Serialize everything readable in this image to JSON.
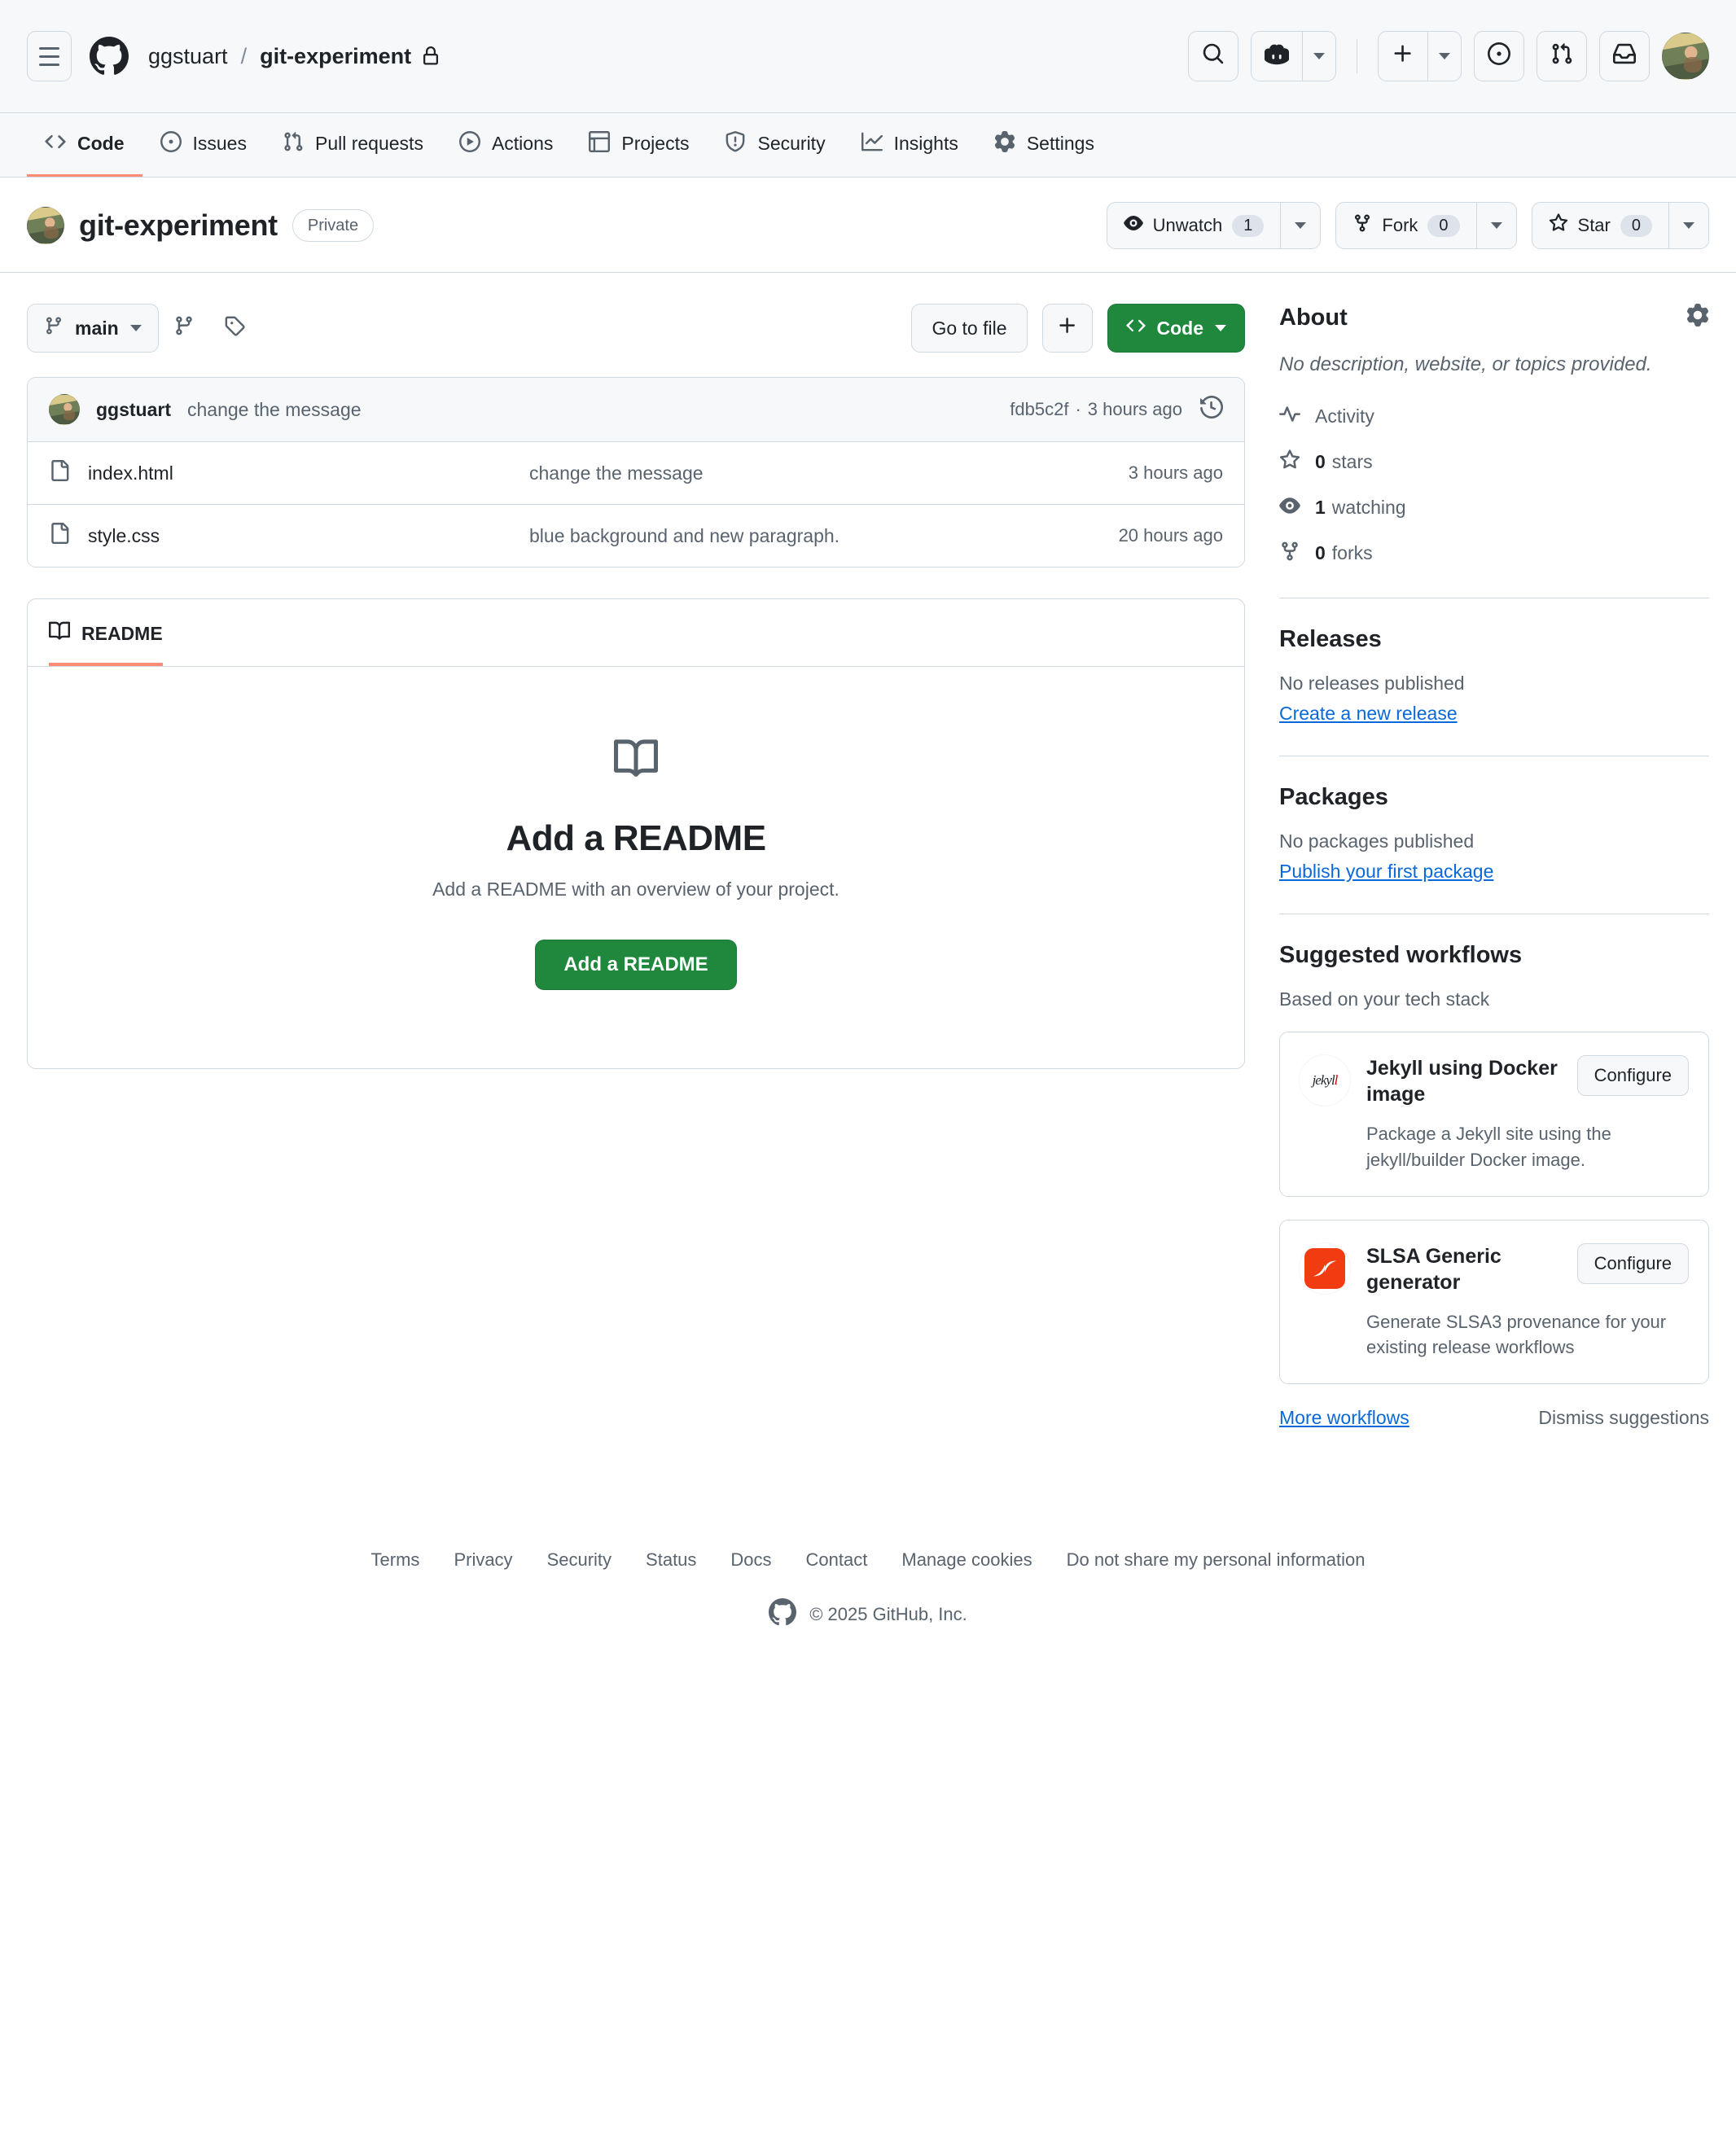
{
  "header": {
    "hamburger_label": "Open menu",
    "owner": "ggstuart",
    "separator": "/",
    "repo": "git-experiment",
    "icons": {
      "github_mark": "github-logo",
      "lock": "lock-icon",
      "search": "search-icon",
      "copilot": "copilot-icon",
      "plus": "plus-icon",
      "issues": "issue-opened-icon",
      "pull_requests": "git-pull-request-icon",
      "inbox": "inbox-icon"
    }
  },
  "repo_nav": {
    "tabs": [
      {
        "label": "Code",
        "icon": "code-icon",
        "active": true
      },
      {
        "label": "Issues",
        "icon": "issue-opened-icon",
        "active": false
      },
      {
        "label": "Pull requests",
        "icon": "git-pull-request-icon",
        "active": false
      },
      {
        "label": "Actions",
        "icon": "play-icon",
        "active": false
      },
      {
        "label": "Projects",
        "icon": "table-icon",
        "active": false
      },
      {
        "label": "Security",
        "icon": "shield-icon",
        "active": false
      },
      {
        "label": "Insights",
        "icon": "graph-icon",
        "active": false
      },
      {
        "label": "Settings",
        "icon": "gear-icon",
        "active": false
      }
    ]
  },
  "repo_title": {
    "name": "git-experiment",
    "visibility": "Private",
    "actions": {
      "watch_label": "Unwatch",
      "watch_count": "1",
      "fork_label": "Fork",
      "fork_count": "0",
      "star_label": "Star",
      "star_count": "0"
    }
  },
  "file_toolbar": {
    "branch": "main",
    "branches_icon": "git-branch-icon",
    "tags_icon": "tag-icon",
    "go_to_file": "Go to file",
    "add_file_icon": "plus-icon",
    "code_label": "Code"
  },
  "commit": {
    "author": "ggstuart",
    "message": "change the message",
    "sha": "fdb5c2f",
    "separator": "·",
    "relative_time": "3 hours ago",
    "history_icon": "history-icon"
  },
  "files": {
    "rows": [
      {
        "name": "index.html",
        "icon": "file-icon",
        "message": "change the message",
        "age": "3 hours ago"
      },
      {
        "name": "style.css",
        "icon": "file-icon",
        "message": "blue background and new paragraph.",
        "age": "20 hours ago"
      }
    ]
  },
  "readme": {
    "tab_label": "README",
    "tab_icon": "book-icon",
    "empty_icon": "book-icon",
    "title": "Add a README",
    "subtitle": "Add a README with an overview of your project.",
    "button": "Add a README"
  },
  "about": {
    "title": "About",
    "settings_icon": "gear-icon",
    "description": "No description, website, or topics provided.",
    "links": [
      {
        "icon": "pulse-icon",
        "value": "",
        "label": "Activity"
      },
      {
        "icon": "star-icon",
        "value": "0",
        "label": "stars"
      },
      {
        "icon": "eye-icon",
        "value": "1",
        "label": "watching"
      },
      {
        "icon": "repo-forked-icon",
        "value": "0",
        "label": "forks"
      }
    ]
  },
  "releases": {
    "title": "Releases",
    "empty": "No releases published",
    "link": "Create a new release"
  },
  "packages": {
    "title": "Packages",
    "empty": "No packages published",
    "link": "Publish your first package"
  },
  "workflows": {
    "title": "Suggested workflows",
    "subtitle": "Based on your tech stack",
    "cards": [
      {
        "logo": "jekyll-logo",
        "title": "Jekyll using Docker image",
        "description": "Package a Jekyll site using the jekyll/builder Docker image.",
        "button": "Configure"
      },
      {
        "logo": "slsa-logo",
        "title": "SLSA Generic generator",
        "description": "Generate SLSA3 provenance for your existing release workflows",
        "button": "Configure"
      }
    ],
    "more_link": "More workflows",
    "dismiss": "Dismiss suggestions"
  },
  "footer": {
    "links": [
      "Terms",
      "Privacy",
      "Security",
      "Status",
      "Docs",
      "Contact",
      "Manage cookies",
      "Do not share my personal information"
    ],
    "copyright": "© 2025 GitHub, Inc.",
    "mark_icon": "github-logo"
  },
  "colors": {
    "accent_green": "#1f883d",
    "link_blue": "#0969da",
    "active_underline": "#fd8c73",
    "muted": "#59636e",
    "border": "#d1d9e0",
    "canvas_subtle": "#f6f8fa"
  }
}
